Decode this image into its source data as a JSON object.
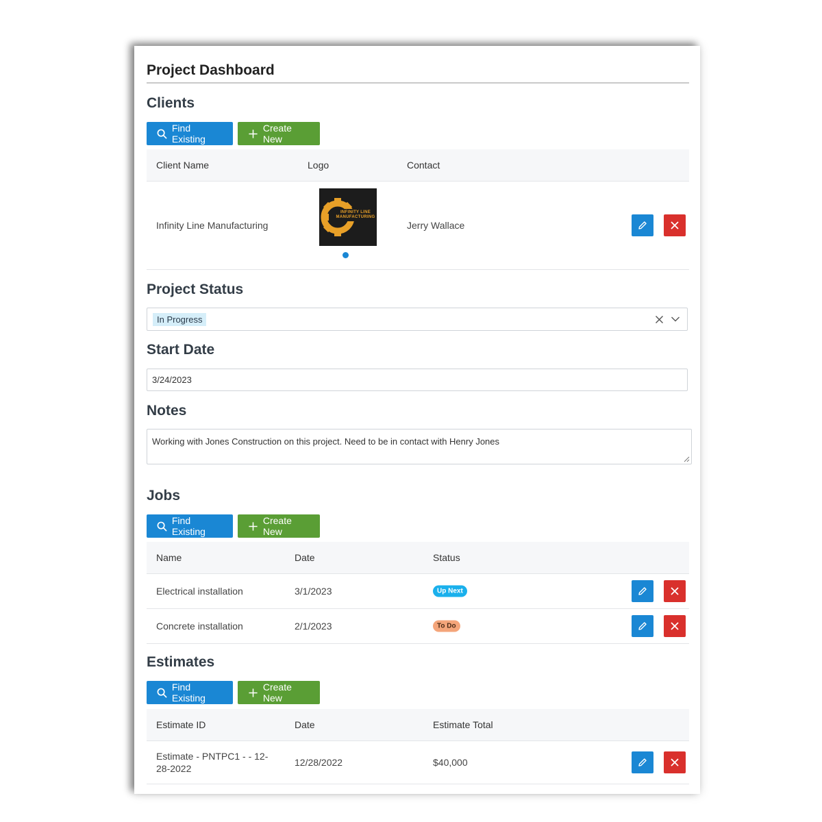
{
  "page": {
    "title": "Project Dashboard"
  },
  "clients": {
    "title": "Clients",
    "find_label": "Find Existing",
    "create_label": "Create New",
    "columns": [
      "Client Name",
      "Logo",
      "Contact"
    ],
    "rows": [
      {
        "name": "Infinity Line Manufacturing",
        "logo_text_1": "INFINITY LINE",
        "logo_text_2": "MANUFACTURING",
        "contact": "Jerry Wallace"
      }
    ]
  },
  "project_status": {
    "title": "Project Status",
    "selected": "In Progress"
  },
  "start_date": {
    "title": "Start Date",
    "value": "3/24/2023"
  },
  "notes": {
    "title": "Notes",
    "value": "Working with Jones Construction on this project. Need to be in contact with Henry Jones"
  },
  "jobs": {
    "title": "Jobs",
    "find_label": "Find Existing",
    "create_label": "Create New",
    "columns": [
      "Name",
      "Date",
      "Status"
    ],
    "rows": [
      {
        "name": "Electrical installation",
        "date": "3/1/2023",
        "status": "Up Next",
        "status_color": "#1ab0ec"
      },
      {
        "name": "Concrete installation",
        "date": "2/1/2023",
        "status": "To Do",
        "status_color": "#f4a57a"
      }
    ]
  },
  "estimates": {
    "title": "Estimates",
    "find_label": "Find Existing",
    "create_label": "Create New",
    "columns": [
      "Estimate ID",
      "Date",
      "Estimate Total"
    ],
    "rows": [
      {
        "id_line1": "Estimate - PNTPC1 - - 12-",
        "id_line2": "28-2022",
        "date": "12/28/2022",
        "total": "$40,000"
      }
    ]
  },
  "colors": {
    "primary_blue": "#1a87d4",
    "create_green": "#5a9e35",
    "delete_red": "#d9302c",
    "tag_bg": "#d5eef9"
  }
}
